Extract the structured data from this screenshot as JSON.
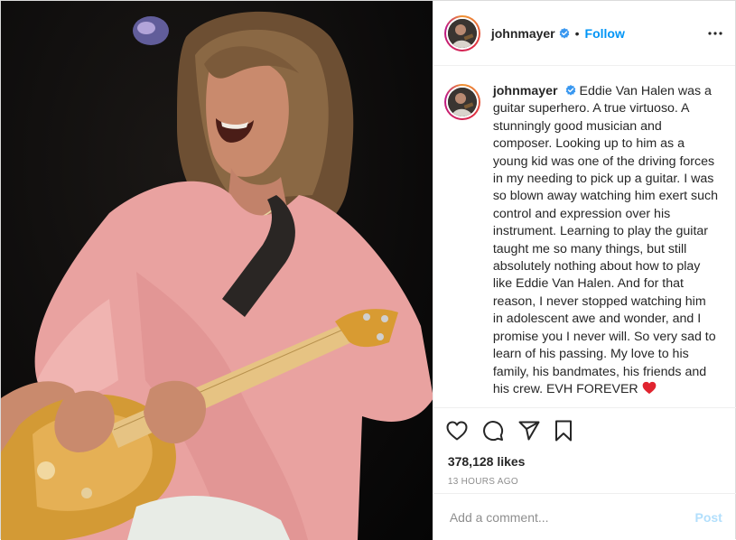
{
  "post": {
    "username": "johnmayer",
    "follow_label": "Follow",
    "dot": "•",
    "caption": {
      "username": "johnmayer",
      "text": "Eddie Van Halen was a guitar superhero. A true virtuoso. A stunningly good musician and composer. Looking up to him as a young kid was one of the driving forces in my needing to pick up a guitar. I was so blown away watching him exert such control and expression over his instrument. Learning to play the guitar taught me so many things, but still absolutely nothing about how to play like Eddie Van Halen. And for that reason, I never stopped watching him in adolescent awe and wonder, and I promise you I never will. So very sad to learn of his passing. My love to his family, his bandmates, his friends and his crew. EVH FOREVER",
      "emoji": "❤️"
    },
    "likes": "378,128 likes",
    "timestamp": "13 HOURS AGO",
    "comment_placeholder": "Add a comment...",
    "post_label": "Post"
  },
  "icons": {
    "verified": "verified-badge-icon",
    "more": "more-options-icon",
    "like": "heart-icon",
    "comment": "comment-bubble-icon",
    "share": "paper-plane-icon",
    "save": "bookmark-icon"
  },
  "colors": {
    "accent": "#0095f6",
    "post_disabled": "#b2dffc",
    "muted": "#8e8e8e",
    "text": "#262626",
    "shirt": "#e9a2a0"
  }
}
